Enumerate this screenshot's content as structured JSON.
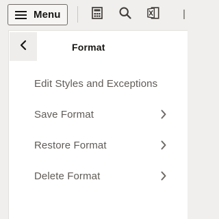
{
  "toolbar": {
    "menu_label": "Menu",
    "icons": [
      "hamburger-icon",
      "calculator-icon",
      "search-icon",
      "excel-export-icon"
    ]
  },
  "panel": {
    "title": "Format",
    "back_icon": "chevron-left-icon",
    "items": [
      {
        "label": "Edit Styles and Exceptions",
        "has_submenu": false
      },
      {
        "label": "Save Format",
        "has_submenu": true
      },
      {
        "label": "Restore Format",
        "has_submenu": true
      },
      {
        "label": "Delete Format",
        "has_submenu": true
      }
    ]
  },
  "colors": {
    "background": "#f0efed",
    "panel": "#ffffff",
    "text_primary": "#161513",
    "text_secondary": "#5f5b56",
    "icon": "#3f3b37"
  }
}
